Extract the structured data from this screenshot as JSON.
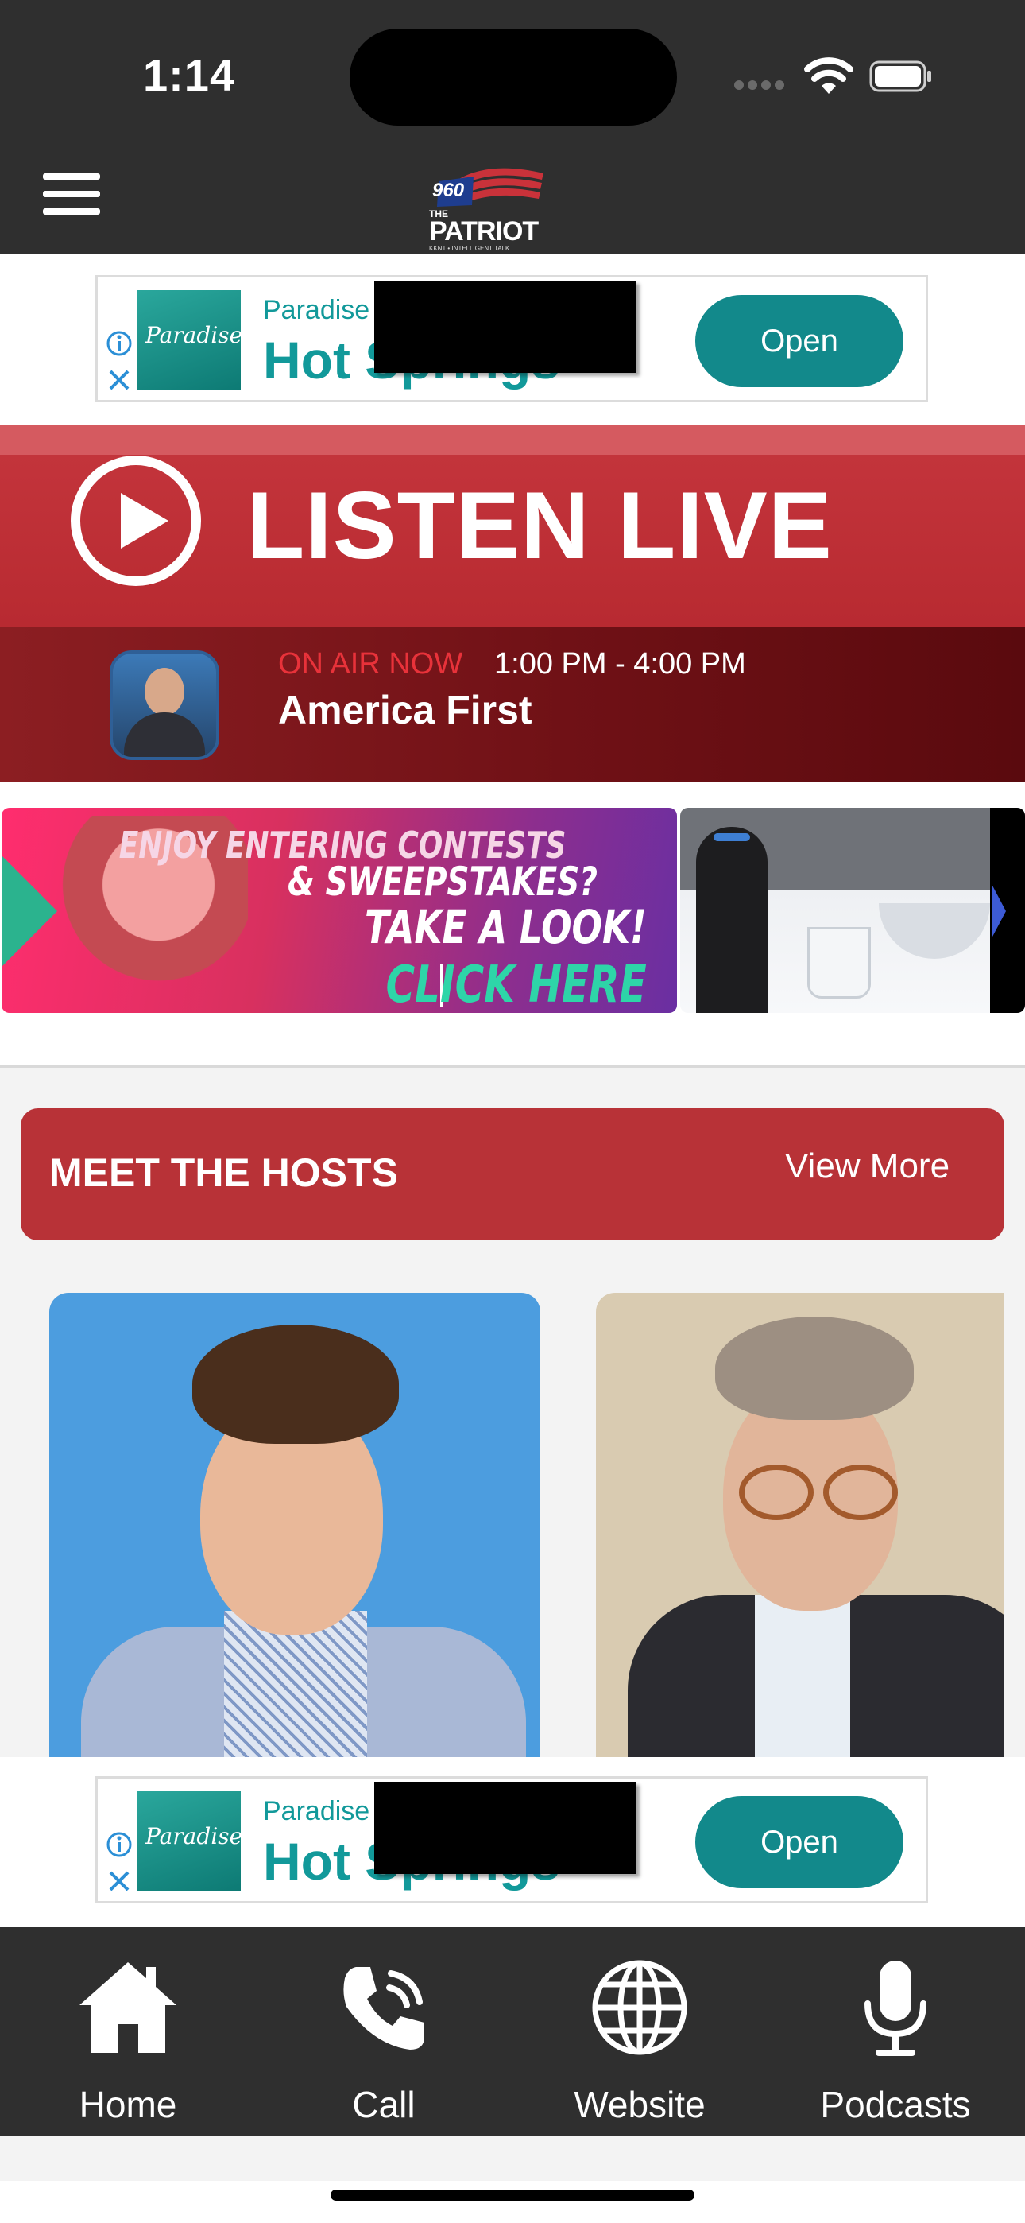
{
  "status_bar": {
    "time": "1:14"
  },
  "header": {
    "logo_text": "960 THE PATRIOT",
    "logo_number": "960",
    "logo_the": "THE",
    "logo_name": "PATRIOT",
    "logo_tagline": "KKNT • INTELLIGENT TALK"
  },
  "ad_top": {
    "brand_small": "Paradise H",
    "headline": "Hot Springs",
    "logo_text": "Paradise",
    "cta": "Open"
  },
  "listen_live": {
    "label": "LISTEN LIVE",
    "on_air_label": "ON AIR NOW",
    "time_range": "1:00 PM - 4:00 PM",
    "show_name": "America First"
  },
  "promos": {
    "contest": {
      "line1": "ENJOY ENTERING CONTESTS",
      "line2": "& SWEEPSTAKES?",
      "line3": "TAKE A LOOK!",
      "line4": "CLICK HERE"
    }
  },
  "hosts": {
    "title": "MEET THE HOSTS",
    "view_more": "View More"
  },
  "ad_bottom": {
    "brand_small": "Paradise H",
    "headline": "Hot Springs",
    "logo_text": "Paradise",
    "cta": "Open"
  },
  "tabbar": {
    "items": [
      {
        "label": "Home",
        "icon": "home-icon"
      },
      {
        "label": "Call",
        "icon": "phone-icon"
      },
      {
        "label": "Website",
        "icon": "globe-icon"
      },
      {
        "label": "Podcasts",
        "icon": "microphone-icon"
      }
    ]
  },
  "colors": {
    "header_bg": "#2f2f2f",
    "brand_red": "#b83237",
    "ad_teal": "#12898b",
    "onair_red": "#e8323a"
  }
}
